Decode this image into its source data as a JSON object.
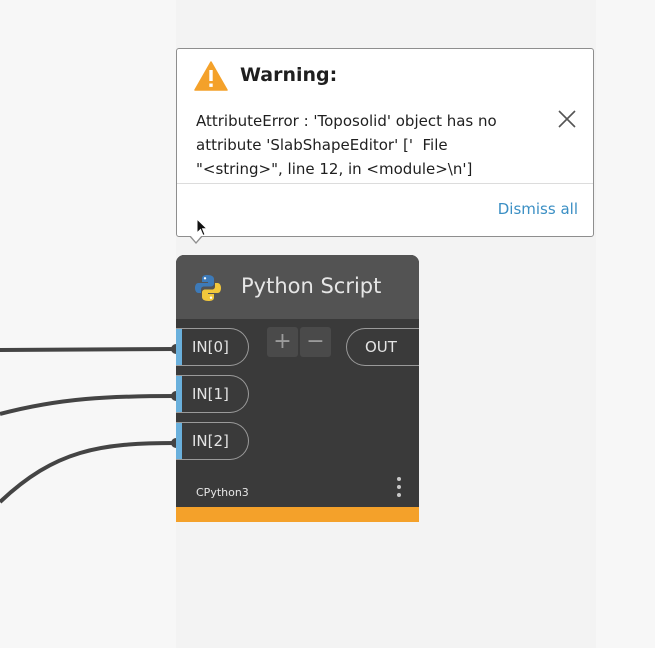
{
  "warning": {
    "title": "Warning:",
    "message": "AttributeError : 'Toposolid' object has no\nattribute 'SlabShapeEditor' ['  File\n\"<string>\", line 12, in <module>\\n']",
    "dismiss_label": "Dismiss all",
    "icon": "warning-triangle-icon",
    "close_icon": "close-icon",
    "accent_color": "#f4a12a",
    "link_color": "#3b8fc4"
  },
  "node": {
    "title": "Python Script",
    "icon": "python-logo-icon",
    "inputs": [
      {
        "label": "IN[0]"
      },
      {
        "label": "IN[1]"
      },
      {
        "label": "IN[2]"
      }
    ],
    "add_label": "+",
    "remove_label": "−",
    "output": {
      "label": "OUT"
    },
    "engine": "CPython3",
    "menu_icon": "kebab-menu-icon",
    "header_color": "#535353",
    "body_color": "#3a3a3a",
    "port_color": "#6ab0dc",
    "status_color": "#f4a12a"
  }
}
